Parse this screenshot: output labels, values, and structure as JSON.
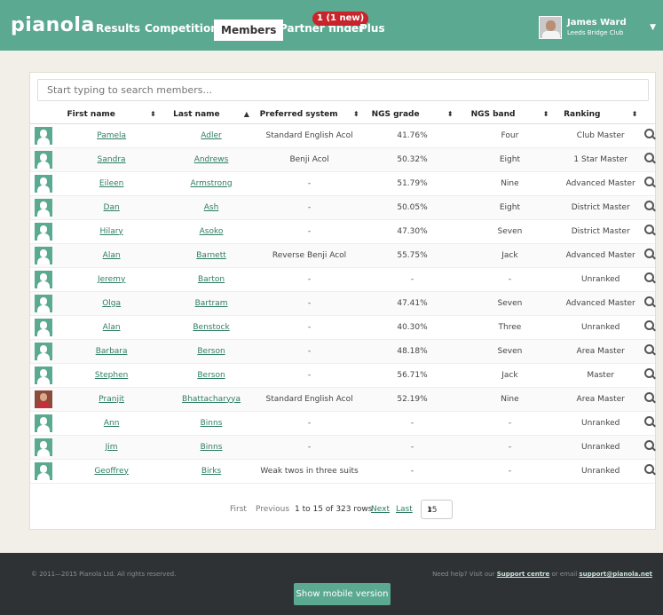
{
  "header": {
    "logo": "pianola",
    "nav": [
      "Results",
      "Competitions",
      "Members",
      "Partner finder",
      "Plus"
    ],
    "badge": "1 (1 new)",
    "user_name": "James Ward",
    "user_club": "Leeds Bridge Club"
  },
  "search": {
    "placeholder": "Start typing to search members..."
  },
  "table": {
    "columns": [
      "First name",
      "Last name",
      "Preferred system",
      "NGS grade",
      "NGS band",
      "Ranking"
    ],
    "rows": [
      {
        "first": "Pamela",
        "last": "Adler",
        "system": "Standard English Acol",
        "grade": "41.76%",
        "band": "Four",
        "ranking": "Club Master"
      },
      {
        "first": "Sandra",
        "last": "Andrews",
        "system": "Benji Acol",
        "grade": "50.32%",
        "band": "Eight",
        "ranking": "1 Star Master"
      },
      {
        "first": "Eileen",
        "last": "Armstrong",
        "system": "-",
        "grade": "51.79%",
        "band": "Nine",
        "ranking": "Advanced Master"
      },
      {
        "first": "Dan",
        "last": "Ash",
        "system": "-",
        "grade": "50.05%",
        "band": "Eight",
        "ranking": "District Master"
      },
      {
        "first": "Hilary",
        "last": "Asoko",
        "system": "-",
        "grade": "47.30%",
        "band": "Seven",
        "ranking": "District Master"
      },
      {
        "first": "Alan",
        "last": "Barnett",
        "system": "Reverse Benji Acol",
        "grade": "55.75%",
        "band": "Jack",
        "ranking": "Advanced Master"
      },
      {
        "first": "Jeremy",
        "last": "Barton",
        "system": "-",
        "grade": "-",
        "band": "-",
        "ranking": "Unranked"
      },
      {
        "first": "Olga",
        "last": "Bartram",
        "system": "-",
        "grade": "47.41%",
        "band": "Seven",
        "ranking": "Advanced Master"
      },
      {
        "first": "Alan",
        "last": "Benstock",
        "system": "-",
        "grade": "40.30%",
        "band": "Three",
        "ranking": "Unranked"
      },
      {
        "first": "Barbara",
        "last": "Berson",
        "system": "-",
        "grade": "48.18%",
        "band": "Seven",
        "ranking": "Area Master"
      },
      {
        "first": "Stephen",
        "last": "Berson",
        "system": "-",
        "grade": "56.71%",
        "band": "Jack",
        "ranking": "Master"
      },
      {
        "first": "Pranjit",
        "last": "Bhattacharyya",
        "system": "Standard English Acol",
        "grade": "52.19%",
        "band": "Nine",
        "ranking": "Area Master"
      },
      {
        "first": "Ann",
        "last": "Binns",
        "system": "-",
        "grade": "-",
        "band": "-",
        "ranking": "Unranked"
      },
      {
        "first": "Jim",
        "last": "Binns",
        "system": "-",
        "grade": "-",
        "band": "-",
        "ranking": "Unranked"
      },
      {
        "first": "Geoffrey",
        "last": "Birks",
        "system": "Weak twos in three suits",
        "grade": "-",
        "band": "-",
        "ranking": "Unranked"
      }
    ]
  },
  "pager": {
    "first": "First",
    "previous": "Previous",
    "range": "1 to 15 of 323 rows",
    "next": "Next",
    "last": "Last",
    "page_size": "15"
  },
  "footer": {
    "copyright": "© 2011—2015 Pianola Ltd. All rights reserved.",
    "help_prefix": "Need help? Visit our",
    "support_centre": "Support centre",
    "help_middle": "or email",
    "support_email": "support@pianola.net",
    "mobile_button": "Show mobile version"
  }
}
